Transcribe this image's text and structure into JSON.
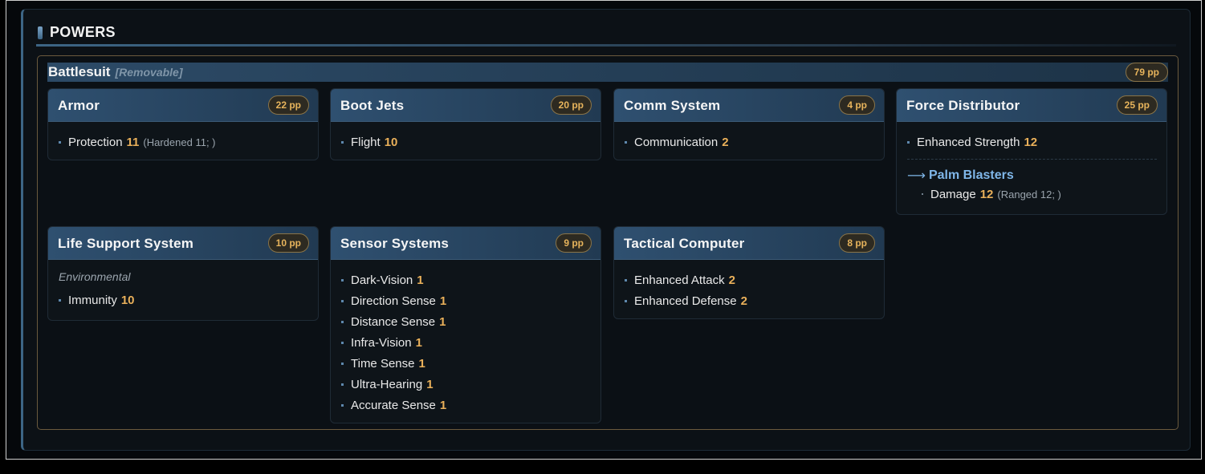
{
  "section": {
    "title": "POWERS"
  },
  "group": {
    "name": "Battlesuit",
    "tag": "[Removable]",
    "cost": "79 pp"
  },
  "cards": {
    "armor": {
      "title": "Armor",
      "cost": "22 pp",
      "items": [
        {
          "name": "Protection",
          "rank": "11",
          "extra": "(Hardened 11; )"
        }
      ]
    },
    "boot_jets": {
      "title": "Boot Jets",
      "cost": "20 pp",
      "items": [
        {
          "name": "Flight",
          "rank": "10"
        }
      ]
    },
    "comm_system": {
      "title": "Comm System",
      "cost": "4 pp",
      "items": [
        {
          "name": "Communication",
          "rank": "2"
        }
      ]
    },
    "force_distributor": {
      "title": "Force Distributor",
      "cost": "25 pp",
      "items": [
        {
          "name": "Enhanced Strength",
          "rank": "12"
        }
      ],
      "alternate": {
        "arrow": "⟶",
        "title": "Palm Blasters",
        "items": [
          {
            "name": "Damage",
            "rank": "12",
            "extra": "(Ranged 12; )"
          }
        ]
      }
    },
    "life_support": {
      "title": "Life Support System",
      "cost": "10 pp",
      "note": "Environmental",
      "items": [
        {
          "name": "Immunity",
          "rank": "10"
        }
      ]
    },
    "sensor_systems": {
      "title": "Sensor Systems",
      "cost": "9 pp",
      "items": [
        {
          "name": "Dark-Vision",
          "rank": "1"
        },
        {
          "name": "Direction Sense",
          "rank": "1"
        },
        {
          "name": "Distance Sense",
          "rank": "1"
        },
        {
          "name": "Infra-Vision",
          "rank": "1"
        },
        {
          "name": "Time Sense",
          "rank": "1"
        },
        {
          "name": "Ultra-Hearing",
          "rank": "1"
        },
        {
          "name": "Accurate Sense",
          "rank": "1"
        }
      ]
    },
    "tactical_computer": {
      "title": "Tactical Computer",
      "cost": "8 pp",
      "items": [
        {
          "name": "Enhanced Attack",
          "rank": "2"
        },
        {
          "name": "Enhanced Defense",
          "rank": "2"
        }
      ]
    }
  },
  "colors": {
    "accent": "#3d6585",
    "rank": "#e9b05a",
    "cost_border": "#8a7448",
    "alt_link": "#7fb6e8"
  }
}
